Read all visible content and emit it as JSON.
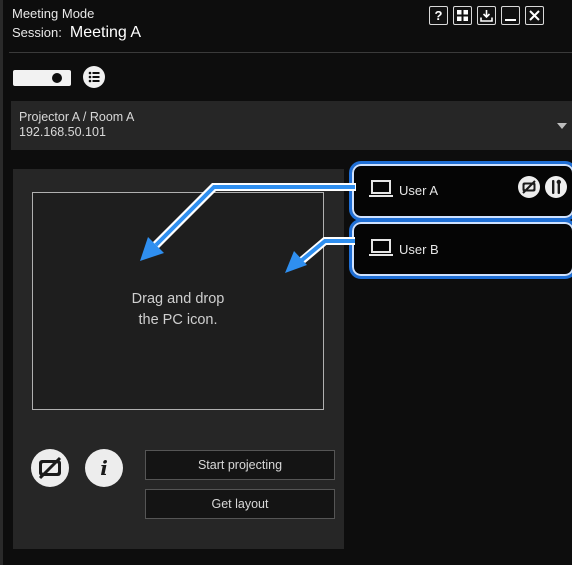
{
  "header": {
    "mode_title": "Meeting Mode",
    "session_label": "Session:",
    "session_name": "Meeting A",
    "buttons": [
      {
        "name": "help",
        "label": "?"
      },
      {
        "name": "layout",
        "label": ""
      },
      {
        "name": "download",
        "label": ""
      },
      {
        "name": "minimize",
        "label": ""
      },
      {
        "name": "close",
        "label": "✕"
      }
    ]
  },
  "toolbar": {
    "icons": [
      "projector-icon",
      "list-icon"
    ]
  },
  "projector": {
    "name": "Projector A / Room A",
    "ip": "192.168.50.101"
  },
  "layout_panel": {
    "drop_hint": "Drag and drop\nthe PC icon.",
    "start_projecting": "Start projecting",
    "get_layout": "Get layout"
  },
  "users": [
    {
      "name": "User A",
      "icons": [
        "no-signal-icon",
        "tools-icon"
      ]
    },
    {
      "name": "User B",
      "icons": []
    }
  ],
  "colors": {
    "accent": "#1f6fd6",
    "arrow": "#2f8ff0",
    "background": "#0d0d0d",
    "panel": "#262626"
  }
}
